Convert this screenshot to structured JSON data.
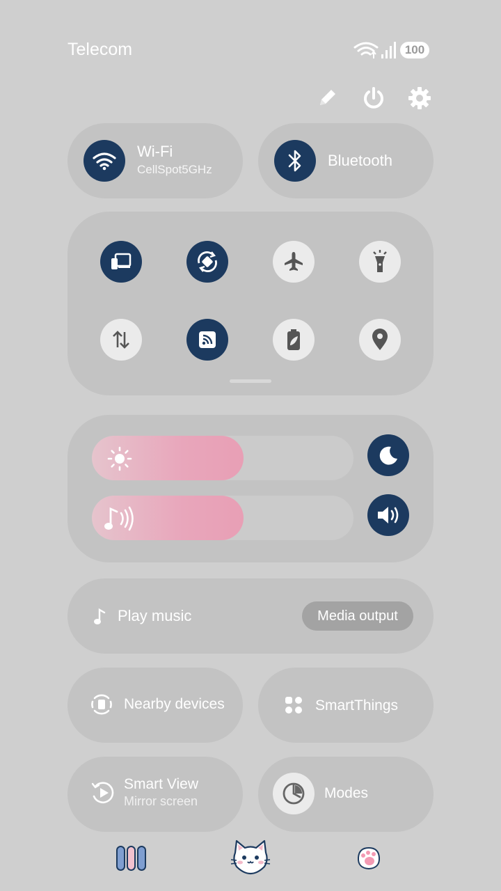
{
  "status_bar": {
    "carrier": "Telecom",
    "battery": "100"
  },
  "header_actions": {
    "edit": "pencil-icon",
    "power": "power-icon",
    "settings": "gear-icon"
  },
  "wifi": {
    "label": "Wi-Fi",
    "network": "CellSpot5GHz",
    "active": true
  },
  "bluetooth": {
    "label": "Bluetooth",
    "active": true
  },
  "quick_toggles": [
    {
      "name": "screen-share",
      "active": true
    },
    {
      "name": "auto-rotate",
      "active": true
    },
    {
      "name": "airplane-mode",
      "active": false
    },
    {
      "name": "flashlight",
      "active": false
    },
    {
      "name": "mobile-data",
      "active": false
    },
    {
      "name": "nfc",
      "active": true
    },
    {
      "name": "power-saving",
      "active": false
    },
    {
      "name": "location",
      "active": false
    }
  ],
  "sliders": {
    "brightness": {
      "level": 0.58
    },
    "volume": {
      "level": 0.58
    }
  },
  "media": {
    "label": "Play music",
    "output_button": "Media output"
  },
  "tiles": {
    "nearby": "Nearby devices",
    "smartthings": "SmartThings",
    "smartview_title": "Smart View",
    "smartview_sub": "Mirror screen",
    "modes": "Modes"
  },
  "colors": {
    "accent": "#1c3a5f",
    "slider_fill": "#e8a0b6",
    "background": "#cfcfcf",
    "tile": "#c3c3c3"
  }
}
